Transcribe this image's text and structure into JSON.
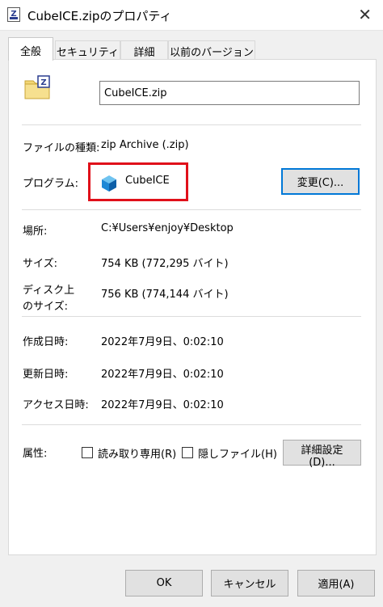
{
  "window": {
    "title": "CubeICE.zipのプロパティ",
    "close_glyph": "✕"
  },
  "tabs": [
    {
      "label": "全般",
      "active": true
    },
    {
      "label": "セキュリティ",
      "active": false
    },
    {
      "label": "詳細",
      "active": false
    },
    {
      "label": "以前のバージョン",
      "active": false
    }
  ],
  "general": {
    "file_name": "CubeICE.zip",
    "file_type_label": "ファイルの種類:",
    "file_type_value": "zip Archive (.zip)",
    "program_label": "プログラム:",
    "program_value": "CubeICE",
    "change_button": "変更(C)...",
    "location_label": "場所:",
    "location_value": "C:¥Users¥enjoy¥Desktop",
    "size_label": "サイズ:",
    "size_value": "754 KB (772,295 バイト)",
    "disk_size_label_1": "ディスク上",
    "disk_size_label_2": "のサイズ:",
    "disk_size_value": "756 KB (774,144 バイト)",
    "created_label": "作成日時:",
    "created_value": "2022年7月9日、0:02:10",
    "modified_label": "更新日時:",
    "modified_value": "2022年7月9日、0:02:10",
    "accessed_label": "アクセス日時:",
    "accessed_value": "2022年7月9日、0:02:10",
    "attributes_label": "属性:",
    "readonly_label": "読み取り専用(R)",
    "readonly_checked": false,
    "hidden_label": "隠しファイル(H)",
    "hidden_checked": false,
    "advanced_button": "詳細設定(D)..."
  },
  "footer": {
    "ok": "OK",
    "cancel": "キャンセル",
    "apply": "適用(A)"
  },
  "colors": {
    "highlight": "#e0101a",
    "focus": "#0078d7"
  }
}
